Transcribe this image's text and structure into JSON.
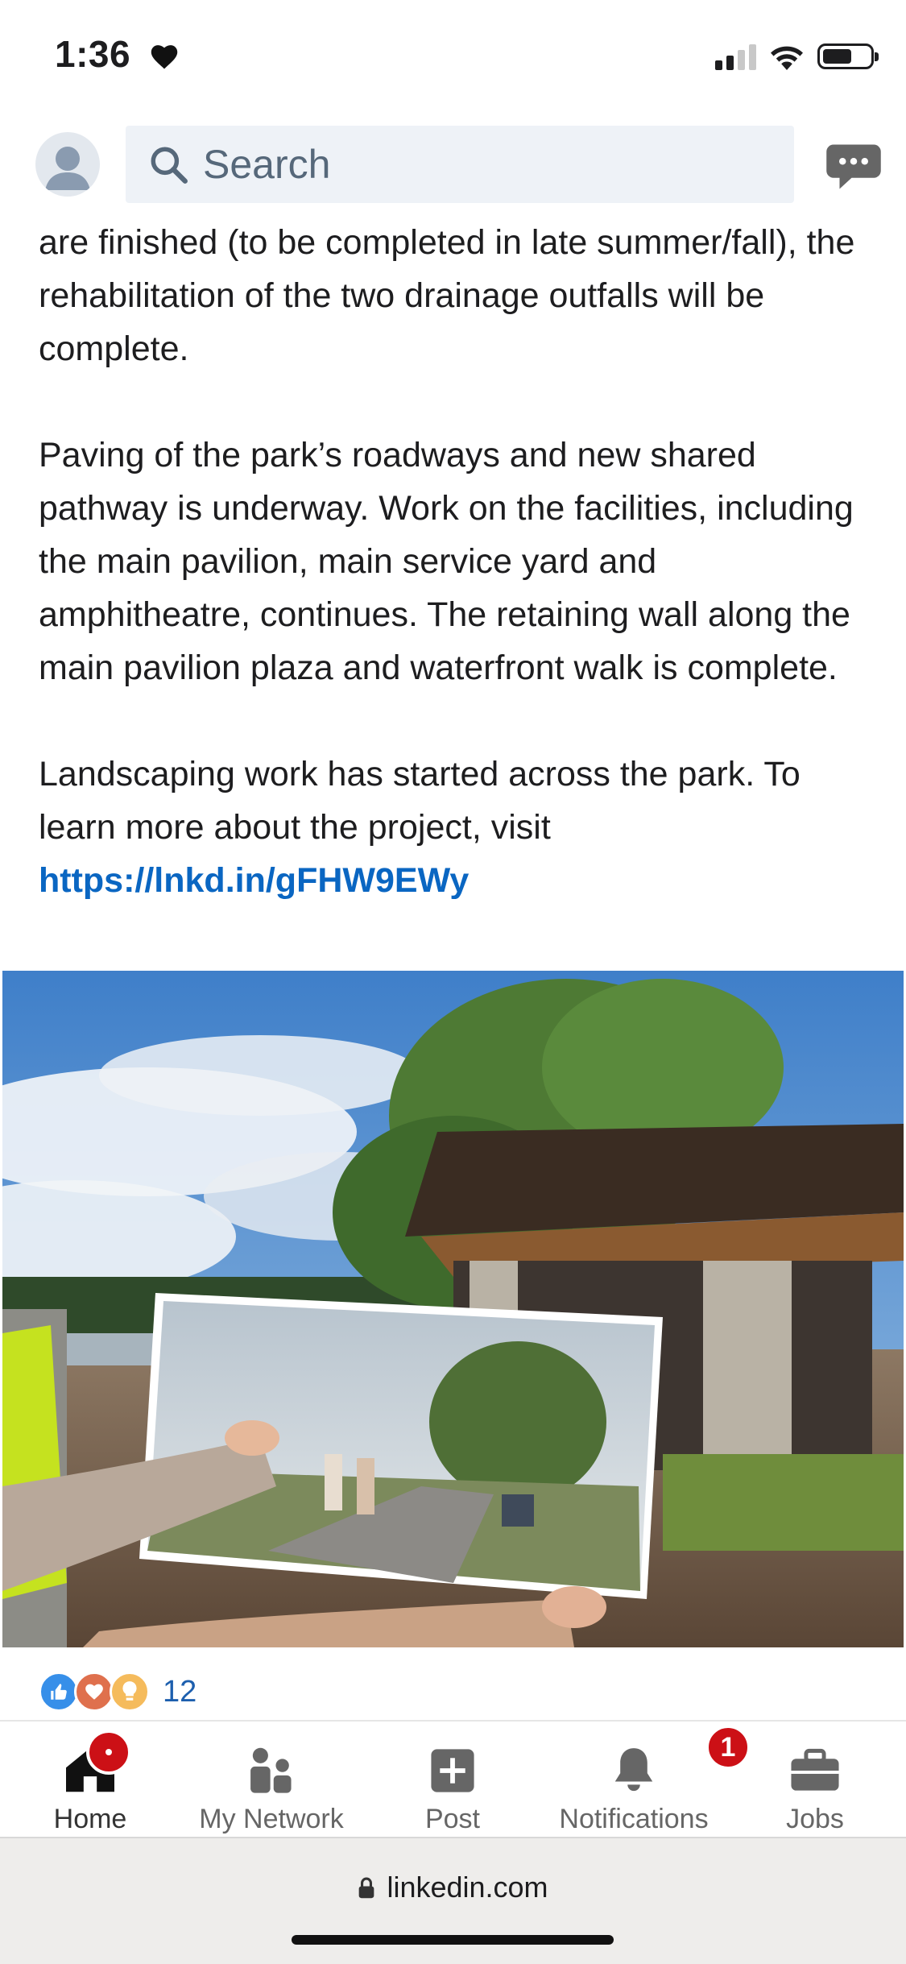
{
  "status": {
    "time": "1:36"
  },
  "search": {
    "label": "Search"
  },
  "post": {
    "para1": "are finished (to be completed in late summer/fall), the rehabilitation of the two drainage outfalls will be complete.",
    "para2": "Paving of the park’s roadways and new shared pathway is underway. Work on the facilities, including the main pavilion, main service yard and amphitheatre, continues. The retaining wall along the main pavilion plaza and waterfront walk is complete.",
    "para3": "Landscaping work has started across the park. To learn more about the project, visit",
    "link": "https://lnkd.in/gFHW9EWy"
  },
  "reactions": {
    "count": "12",
    "types": [
      "like-icon",
      "love-icon",
      "insightful-icon"
    ]
  },
  "nav": {
    "home": "Home",
    "network": "My Network",
    "post": "Post",
    "notifications": "Notifications",
    "notifications_badge": "1",
    "jobs": "Jobs"
  },
  "browser": {
    "url": "linkedin.com"
  },
  "colors": {
    "link": "#0a66c2",
    "badge": "#cc1016"
  }
}
